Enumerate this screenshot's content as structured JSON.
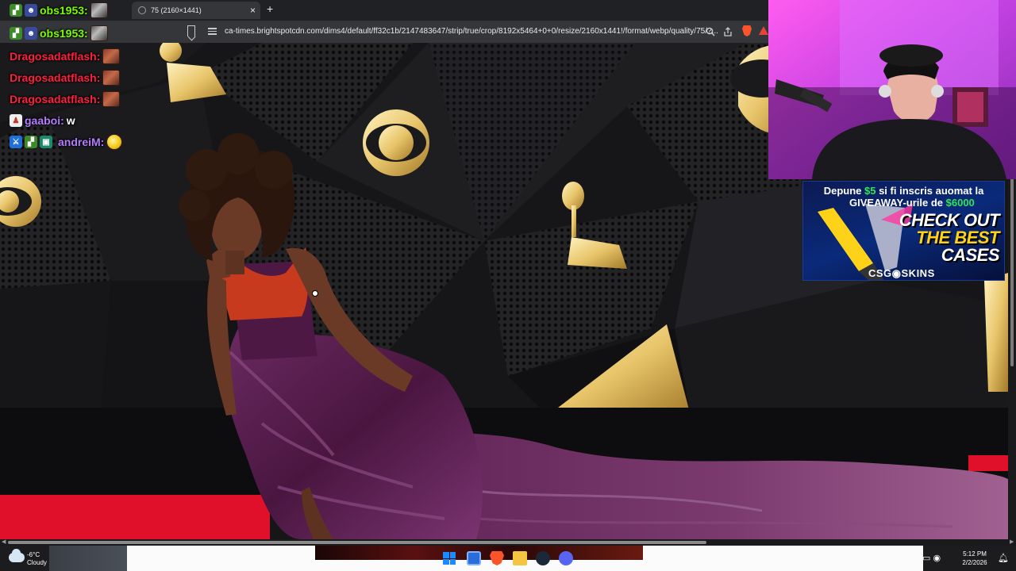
{
  "browser": {
    "tab_title": "75 (2160×1441)",
    "tab_close": "×",
    "new_tab": "+",
    "url": "ca-times.brightspotcdn.com/dims4/default/ff32c1b/2147483647/strip/true/crop/8192x5464+0+0/resize/2160x1441!/format/webp/quality/75/?...",
    "icons": [
      "bookmark-icon",
      "site-info-icon",
      "zoom-icon",
      "share-icon",
      "brave-shield-icon",
      "brave-rewards-icon"
    ]
  },
  "chat": [
    {
      "user": "obs1953:",
      "color": "#7CFC00",
      "badges": [
        "pixel-creature-badge",
        "robot-badge"
      ],
      "message": "",
      "emote": "camera-emote"
    },
    {
      "user": "obs1953:",
      "color": "#7CFC00",
      "badges": [
        "pixel-creature-badge",
        "robot-badge"
      ],
      "message": "",
      "emote": "camera-emote"
    },
    {
      "user": "Dragosadatflash:",
      "color": "#ff1f3d",
      "badges": [],
      "message": "",
      "emote": "face-emote"
    },
    {
      "user": "Dragosadatflash:",
      "color": "#ff1f3d",
      "badges": [],
      "message": "",
      "emote": "face-emote"
    },
    {
      "user": "Dragosadatflash:",
      "color": "#ff1f3d",
      "badges": [],
      "message": "",
      "emote": "face-emote"
    },
    {
      "user": "gaaboi:",
      "color": "#b57bff",
      "badges": [
        "ghost-badge"
      ],
      "message": "w",
      "emote": ""
    },
    {
      "user": "andreiM:",
      "color": "#b57bff",
      "badges": [
        "sword-badge",
        "pixel-creature-badge",
        "gift-badge"
      ],
      "message": "",
      "emote": "lemon-emote"
    }
  ],
  "ad": {
    "line1_pre": "Depune ",
    "line1_amount": "$5",
    "line1_post": " si fi inscris auomat la",
    "line2_pre": "GIVEAWAY-urile de ",
    "line2_amount": "$6000",
    "headline1": "CHECK OUT",
    "headline2": "THE BEST",
    "headline3": "CASES",
    "brand": "CSG◉SKINS",
    "accent": "#2ee65a",
    "highlight": "#ffd21a"
  },
  "taskbar": {
    "temperature": "-6°C",
    "condition": "Cloudy",
    "time": "5:12 PM",
    "date": "2/2/2026",
    "apps": [
      "windows-start-icon",
      "file-explorer-icon",
      "brave-browser-icon",
      "folder-icon",
      "steam-icon",
      "discord-icon"
    ]
  },
  "colors": {
    "chrome_dark": "#202124",
    "address_bar": "#35363a",
    "carpet_red": "#e0102a",
    "gown_purple": "#5a1e4e",
    "grammy_gold": "#e8c56a",
    "webcam_pink": "#e040ff"
  }
}
